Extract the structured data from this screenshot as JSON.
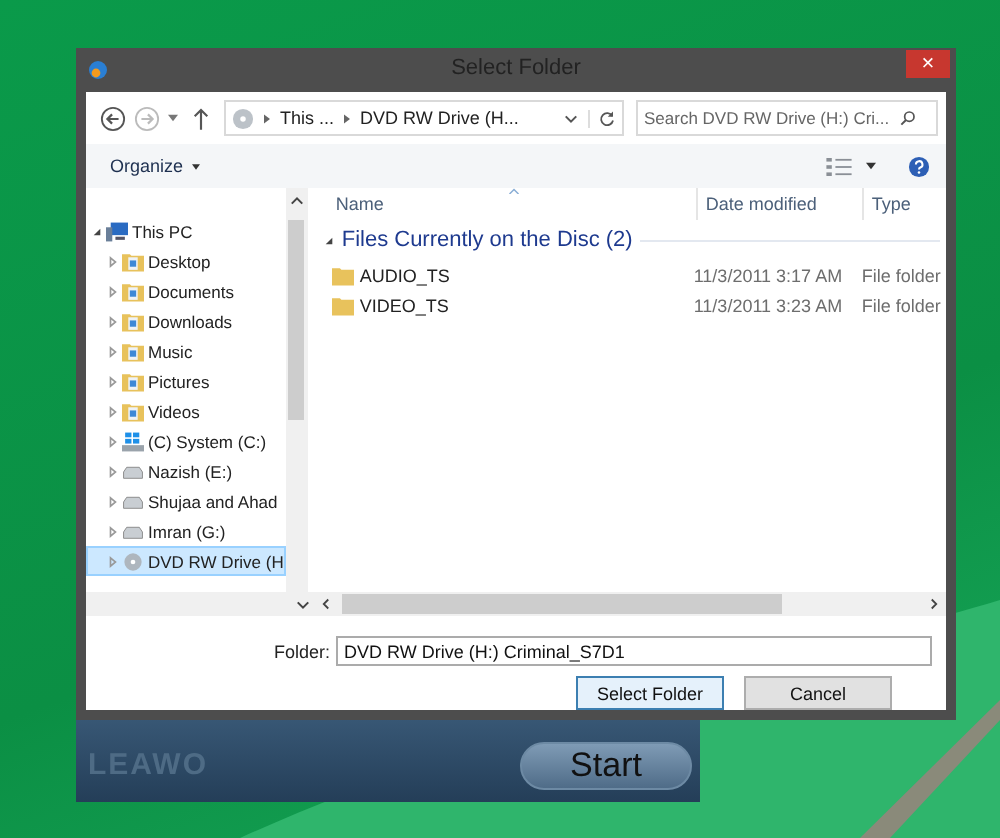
{
  "app": {
    "logo": "LEAWO",
    "start_button": "Start"
  },
  "dialog": {
    "title": "Select Folder",
    "close": "×",
    "address": {
      "crumbs": [
        "This ...",
        "DVD RW Drive (H..."
      ]
    },
    "search": {
      "placeholder": "Search DVD RW Drive (H:) Cri..."
    },
    "toolbar": {
      "organize": "Organize"
    },
    "tree": [
      {
        "label": "This PC",
        "kind": "pc",
        "expanded": true,
        "selected": false,
        "children": [
          {
            "label": "Desktop",
            "kind": "folder",
            "expanded": false,
            "selected": false
          },
          {
            "label": "Documents",
            "kind": "folder",
            "expanded": false,
            "selected": false
          },
          {
            "label": "Downloads",
            "kind": "folder",
            "expanded": false,
            "selected": false
          },
          {
            "label": "Music",
            "kind": "folder",
            "expanded": false,
            "selected": false
          },
          {
            "label": "Pictures",
            "kind": "folder",
            "expanded": false,
            "selected": false
          },
          {
            "label": "Videos",
            "kind": "folder",
            "expanded": false,
            "selected": false
          },
          {
            "label": "(C) System (C:)",
            "kind": "system",
            "expanded": false,
            "selected": false
          },
          {
            "label": "Nazish (E:)",
            "kind": "drive",
            "expanded": false,
            "selected": false
          },
          {
            "label": "Shujaa and Ahad",
            "kind": "drive",
            "expanded": false,
            "selected": false
          },
          {
            "label": "Imran (G:)",
            "kind": "drive",
            "expanded": false,
            "selected": false
          },
          {
            "label": "DVD RW Drive (H",
            "kind": "disc",
            "expanded": false,
            "selected": true
          }
        ]
      }
    ],
    "columns": [
      "Name",
      "Date modified",
      "Type"
    ],
    "group": "Files Currently on the Disc (2)",
    "rows": [
      {
        "name": "AUDIO_TS",
        "date": "11/3/2011 3:17 AM",
        "type": "File folder"
      },
      {
        "name": "VIDEO_TS",
        "date": "11/3/2011 3:23 AM",
        "type": "File folder"
      }
    ],
    "folder": {
      "label": "Folder:",
      "value": "DVD RW Drive (H:) Criminal_S7D1"
    },
    "buttons": [
      {
        "label": "Select Folder",
        "default": true
      },
      {
        "label": "Cancel",
        "default": false
      }
    ]
  }
}
